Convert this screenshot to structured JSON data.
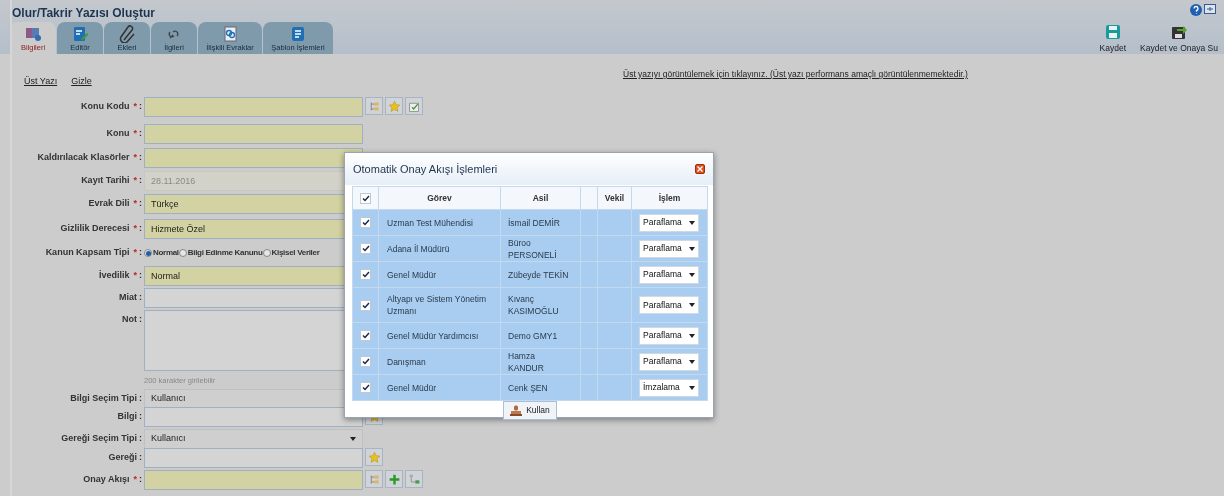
{
  "window": {
    "title": "Olur/Takrir Yazısı Oluştur"
  },
  "tabs": [
    {
      "label": "Bilgileri",
      "selected": true
    },
    {
      "label": "Editör",
      "selected": false
    },
    {
      "label": "Ekleri",
      "selected": false
    },
    {
      "label": "İlgileri",
      "selected": false
    },
    {
      "label": "İlişkili Evraklar",
      "selected": false
    },
    {
      "label": "Şablon İşlemleri",
      "selected": false
    }
  ],
  "toolbar": [
    {
      "label": "Kaydet"
    },
    {
      "label": "Kaydet ve Onaya Su"
    }
  ],
  "links": [
    "Üst Yazı",
    "Gizle"
  ],
  "notice": "Üst yazıyı görüntülemek için tıklayınız. (Üst yazı performans amaçlı görüntülenmemektedir.)",
  "form": [
    {
      "label": "Konu Kodu",
      "star": "*",
      "colon": ":",
      "kind": "text",
      "required": true,
      "buttons": [
        {
          "kind": "tree"
        },
        {
          "kind": "star"
        },
        {
          "kind": "check"
        }
      ]
    },
    {
      "label": "Konu",
      "star": "*",
      "colon": ":",
      "kind": "text",
      "required": true
    },
    {
      "label": "Kaldırılacak Klasörler",
      "star": "*",
      "colon": ":",
      "kind": "text",
      "required": true
    },
    {
      "label": "Kayıt Tarihi",
      "star": "*",
      "colon": ":",
      "kind": "text",
      "required": true,
      "disabled": true,
      "value": "28.11.2016"
    },
    {
      "label": "Evrak Dili",
      "star": "*",
      "colon": ":",
      "kind": "text",
      "required": true,
      "value": "Türkçe"
    },
    {
      "label": "Gizlilik Derecesi",
      "star": "*",
      "colon": ":",
      "kind": "text",
      "required": true,
      "value": "Hizmete Özel"
    },
    {
      "label": "Kanun Kapsam Tipi",
      "star": "*",
      "colon": ":",
      "kind": "radio",
      "options": [
        {
          "label": "Normal",
          "selected": true
        },
        {
          "label": "Bilgi Edinme Kanunu",
          "selected": false
        },
        {
          "label": "Kişisel Veriler",
          "selected": false
        }
      ]
    },
    {
      "label": "İvedilik",
      "star": "*",
      "colon": ":",
      "kind": "text",
      "required": true,
      "value": "Normal"
    },
    {
      "label": "Miat",
      "colon": ":",
      "kind": "text",
      "required": false
    },
    {
      "label": "Not",
      "colon": ":",
      "kind": "textarea",
      "hint": "200 karakter girilebilir"
    },
    {
      "label": "Bilgi Seçim Tipi",
      "colon": ":",
      "kind": "select",
      "value": "Kullanıcı"
    },
    {
      "label": "Bilgi",
      "colon": ":",
      "kind": "text",
      "required": false,
      "buttons": [
        {
          "kind": "star"
        }
      ]
    },
    {
      "label": "Gereği Seçim Tipi",
      "colon": ":",
      "kind": "select",
      "value": "Kullanıcı"
    },
    {
      "label": "Gereği",
      "colon": ":",
      "kind": "text",
      "required": false,
      "buttons": [
        {
          "kind": "star"
        }
      ]
    },
    {
      "label": "Onay Akışı",
      "star": "*",
      "colon": ":",
      "kind": "text",
      "required": true,
      "buttons": [
        {
          "kind": "tree"
        },
        {
          "kind": "plus"
        },
        {
          "kind": "branch"
        }
      ]
    }
  ],
  "dialog": {
    "title": "Otomatik Onay Akışı İşlemleri",
    "all_checked": true,
    "columns": [
      "Görev",
      "Asil",
      "Vekil",
      "İşlem"
    ],
    "rows": [
      {
        "gorev": "Uzman Test Mühendisi",
        "asil": "İsmail DEMİR",
        "islem": "Paraflama",
        "checked": true
      },
      {
        "gorev": "Adana İl Müdürü",
        "asil": "Büroo PERSONELİ",
        "islem": "Paraflama",
        "checked": true
      },
      {
        "gorev": "Genel Müdür",
        "asil": "Zübeyde TEKİN",
        "islem": "Paraflama",
        "checked": true
      },
      {
        "gorev": "Altyapı ve Sistem Yönetim Uzmanı",
        "asil": "Kıvanç KASIMOĞLU",
        "islem": "Paraflama",
        "checked": true
      },
      {
        "gorev": "Genel Müdür Yardımcısı",
        "asil": "Demo GMY1",
        "islem": "Paraflama",
        "checked": true
      },
      {
        "gorev": "Danışman",
        "asil": "Hamza KANDUR",
        "islem": "Paraflama",
        "checked": true
      },
      {
        "gorev": "Genel Müdür",
        "asil": "Cenk ŞEN",
        "islem": "İmzalama",
        "checked": true
      }
    ],
    "button": "Kullan"
  }
}
